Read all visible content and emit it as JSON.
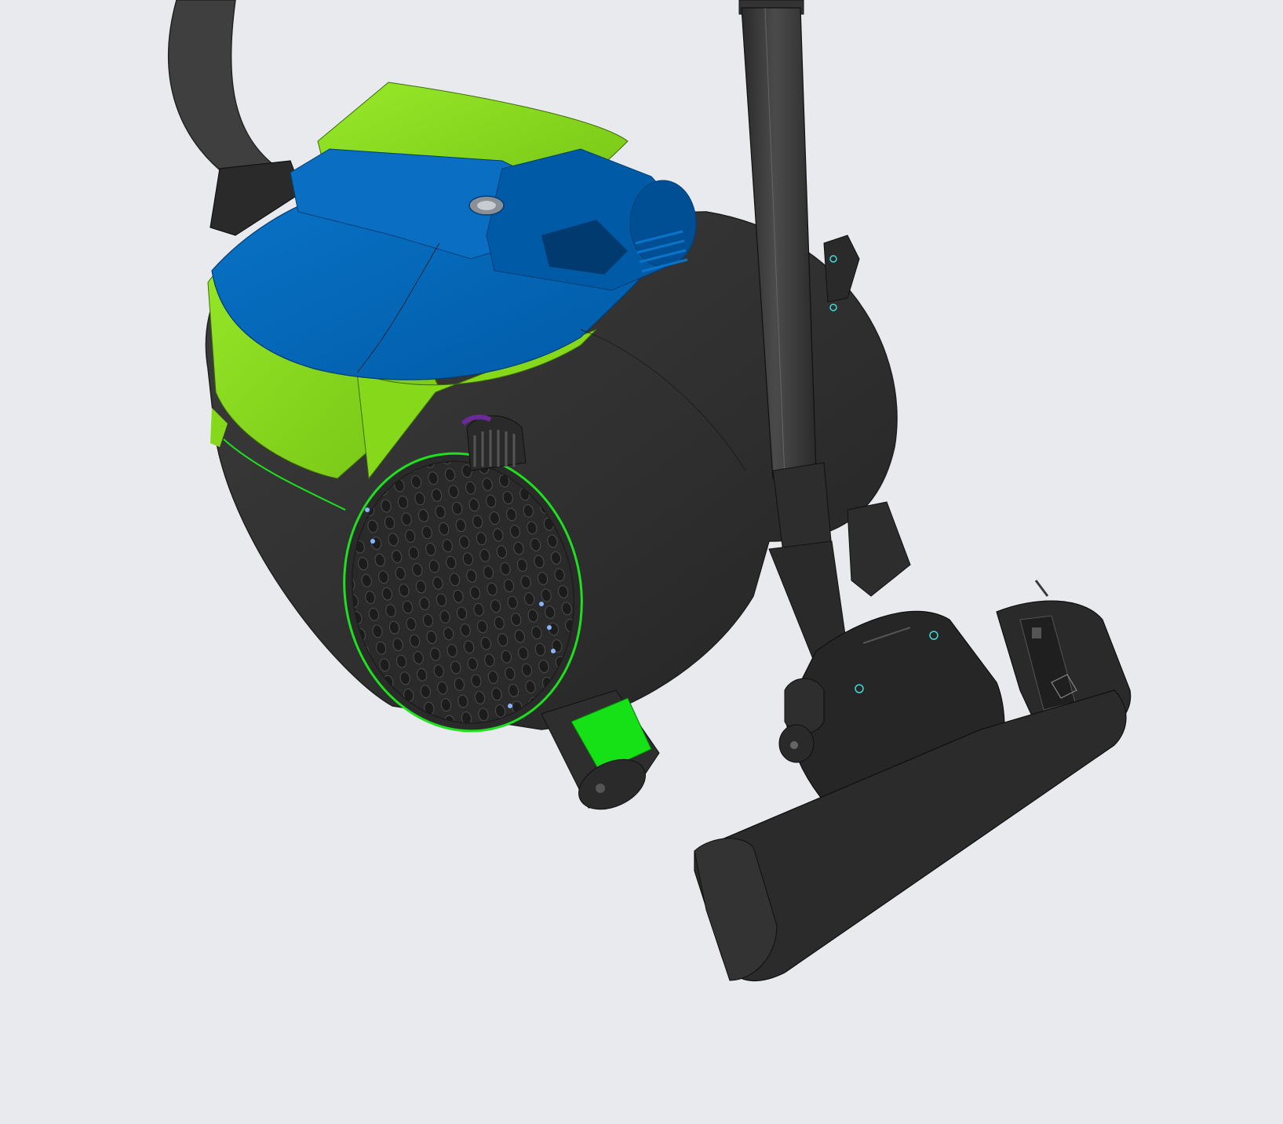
{
  "viewport": {
    "background": "#e8eaee",
    "model": {
      "name": "vacuum-cleaner",
      "colors": {
        "body_dark": "#2d2d2d",
        "body_mid": "#3a3a3a",
        "lid_blue": "#0066b8",
        "lid_blue_dark": "#004f94",
        "shell_green": "#86d81a",
        "green_highlight": "#1ee01e",
        "edge_cyan": "#3fd9d9",
        "edge_purple": "#6b2a9a"
      }
    }
  }
}
